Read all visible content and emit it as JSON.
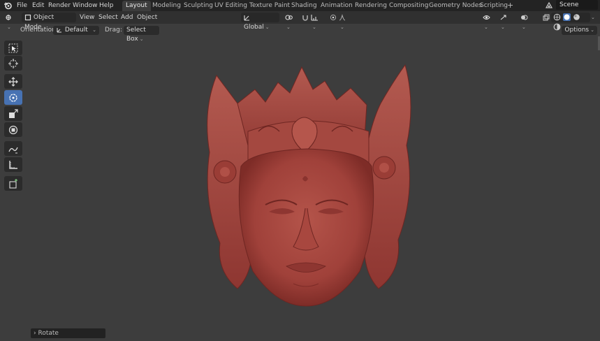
{
  "menu": [
    "File",
    "Edit",
    "Render",
    "Window",
    "Help"
  ],
  "workspaces": [
    "Layout",
    "Modeling",
    "Sculpting",
    "UV Editing",
    "Texture Paint",
    "Shading",
    "Animation",
    "Rendering",
    "Compositing",
    "Geometry Nodes",
    "Scripting"
  ],
  "active_workspace": "Layout",
  "add_workspace": "+",
  "scene": "Scene",
  "header": {
    "mode": "Object Mode",
    "view": "View",
    "select": "Select",
    "add": "Add",
    "object": "Object",
    "transform_orientation": "Global"
  },
  "subheader": {
    "orientation_label": "Orientation:",
    "orientation_value": "Default",
    "drag_label": "Drag:",
    "drag_value": "Select Box",
    "options": "Options"
  },
  "tools": [
    "select-box-icon",
    "cursor-icon",
    "move-icon",
    "rotate-icon",
    "scale-icon",
    "transform-icon",
    "annotate-icon",
    "measure-icon",
    "add-cube-icon"
  ],
  "active_tool": "rotate-icon",
  "last_operator": "Rotate",
  "colors": {
    "accent": "#4772b3",
    "viewport": "#3d3d3d",
    "model": "#a8453c"
  }
}
